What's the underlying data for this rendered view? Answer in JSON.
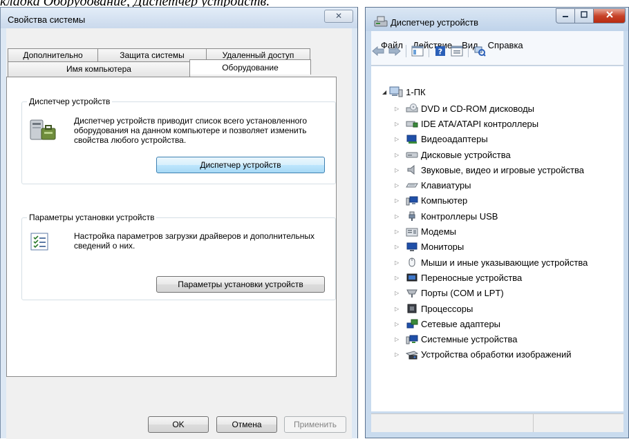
{
  "caption": {
    "text": "кладка Оборудование, Диспетчер устройств."
  },
  "system_properties": {
    "title": "Свойства системы",
    "close_glyph": "✕",
    "tabs_top": [
      "Дополнительно",
      "Защита системы",
      "Удаленный доступ"
    ],
    "tabs_bottom": [
      "Имя компьютера",
      "Оборудование"
    ],
    "active_tab": "Оборудование",
    "device_manager_group": {
      "title": "Диспетчер устройств",
      "description": "Диспетчер устройств приводит список всего установленного оборудования на данном компьютере и позволяет изменить свойства любого устройства.",
      "button_label": "Диспетчер устройств"
    },
    "install_settings_group": {
      "title": "Параметры установки устройств",
      "description": "Настройка параметров загрузки драйверов и дополнительных сведений о них.",
      "button_label": "Параметры установки устройств"
    },
    "buttons": {
      "ok": "OK",
      "cancel": "Отмена",
      "apply": "Применить"
    }
  },
  "device_manager": {
    "title": "Диспетчер устройств",
    "menu": [
      "Файл",
      "Действие",
      "Вид",
      "Справка"
    ],
    "tree": {
      "root": "1-ПК",
      "items": [
        {
          "label": "DVD и CD-ROM дисководы",
          "icon": "optical-drive-icon"
        },
        {
          "label": "IDE ATA/ATAPI контроллеры",
          "icon": "ide-controller-icon"
        },
        {
          "label": "Видеоадаптеры",
          "icon": "display-adapter-icon"
        },
        {
          "label": "Дисковые устройства",
          "icon": "disk-drive-icon"
        },
        {
          "label": "Звуковые, видео и игровые устройства",
          "icon": "speaker-icon"
        },
        {
          "label": "Клавиатуры",
          "icon": "keyboard-icon"
        },
        {
          "label": "Компьютер",
          "icon": "computer-icon"
        },
        {
          "label": "Контроллеры USB",
          "icon": "usb-icon"
        },
        {
          "label": "Модемы",
          "icon": "modem-icon"
        },
        {
          "label": "Мониторы",
          "icon": "monitor-icon"
        },
        {
          "label": "Мыши и иные указывающие устройства",
          "icon": "mouse-icon"
        },
        {
          "label": "Переносные устройства",
          "icon": "portable-device-icon"
        },
        {
          "label": "Порты (COM и LPT)",
          "icon": "port-icon"
        },
        {
          "label": "Процессоры",
          "icon": "processor-icon"
        },
        {
          "label": "Сетевые адаптеры",
          "icon": "network-adapter-icon"
        },
        {
          "label": "Системные устройства",
          "icon": "system-device-icon"
        },
        {
          "label": "Устройства обработки изображений",
          "icon": "imaging-device-icon"
        }
      ]
    }
  }
}
